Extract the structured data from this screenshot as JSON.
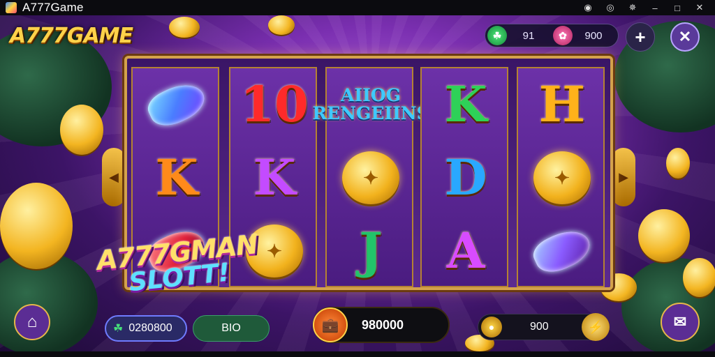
{
  "window": {
    "title": "A777Game",
    "controls": [
      "◉",
      "◎",
      "✵",
      "–",
      "□",
      "✕"
    ]
  },
  "game": {
    "logo": "A777GAME",
    "wallet": {
      "primary_value": "91",
      "secondary_value": "900"
    },
    "overlay_line1": "A777GMAN",
    "overlay_line2": "SLOTT!",
    "reels": [
      [
        {
          "type": "gem",
          "color": "blue"
        },
        {
          "type": "letter",
          "text": "K",
          "color": "#ff8a1a"
        },
        {
          "type": "gem",
          "color": "red"
        }
      ],
      [
        {
          "type": "letter",
          "text": "10",
          "color": "#ff2a2a"
        },
        {
          "type": "letter",
          "text": "K",
          "color": "#c34bff"
        },
        {
          "type": "coin"
        }
      ],
      [
        {
          "type": "banner",
          "text": "AIIOG RENGEIINS"
        },
        {
          "type": "coin"
        },
        {
          "type": "letter",
          "text": "J",
          "color": "#22c46a"
        }
      ],
      [
        {
          "type": "letter",
          "text": "K",
          "color": "#2ed158"
        },
        {
          "type": "letter",
          "text": "D",
          "color": "#29a8ff"
        },
        {
          "type": "letter",
          "text": "A",
          "color": "#d84bff"
        }
      ],
      [
        {
          "type": "letter",
          "text": "H",
          "color": "#ffb21a"
        },
        {
          "type": "coin"
        },
        {
          "type": "gem",
          "color": "purple"
        }
      ]
    ],
    "bottom": {
      "credit_value": "0280800",
      "bet_label": "BIO",
      "spin_value": "980000",
      "win_value": "900"
    }
  },
  "colors": {
    "accent": "#ffd24a",
    "frame": "#d4a24c",
    "panel": "#1a1230"
  }
}
